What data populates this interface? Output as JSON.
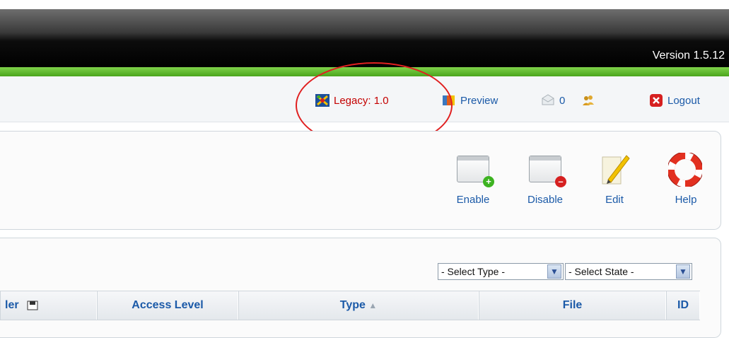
{
  "header": {
    "version": "Version 1.5.12"
  },
  "status_bar": {
    "legacy": "Legacy: 1.0",
    "preview": "Preview",
    "messages_count": "0",
    "users_count": "",
    "logout": "Logout"
  },
  "toolbar": {
    "enable": "Enable",
    "disable": "Disable",
    "edit": "Edit",
    "help": "Help"
  },
  "filters": {
    "type_select": "- Select Type -",
    "state_select": "- Select State -"
  },
  "table": {
    "columns": [
      "ler",
      "Access Level",
      "Type",
      "File",
      "ID"
    ],
    "sorted_column": "Type"
  },
  "colors": {
    "legacy_text": "#c40000",
    "link": "#1b5aa8",
    "green_bar": "#5ab82a",
    "highlight": "#e02020"
  }
}
